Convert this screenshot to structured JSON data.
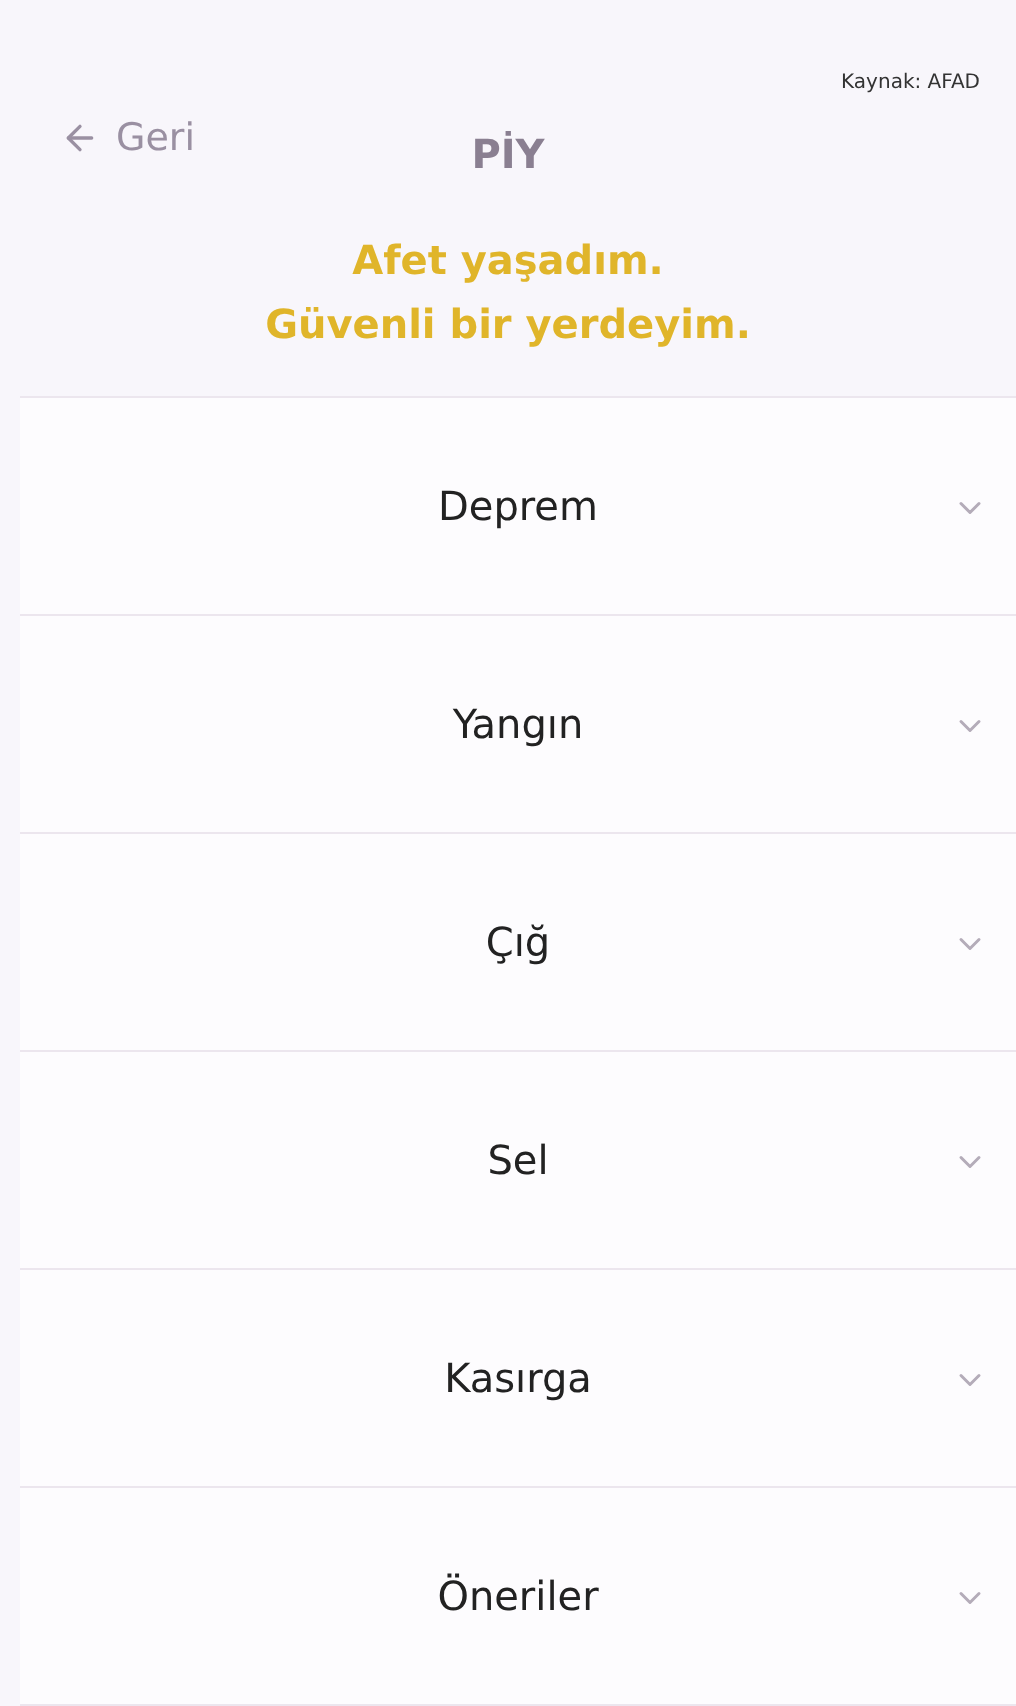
{
  "header": {
    "back": "Geri",
    "title": "PİY",
    "source": "Kaynak: AFAD",
    "heading": [
      "Afet yaşadım.",
      "Güvenli bir yerdeyim."
    ]
  },
  "sections": [
    {
      "label": "Deprem",
      "expanded": false
    },
    {
      "label": "Yangın",
      "expanded": false
    },
    {
      "label": "Çığ",
      "expanded": false
    },
    {
      "label": "Sel",
      "expanded": false
    },
    {
      "label": "Kasırga",
      "expanded": false
    },
    {
      "label": "Öneriler",
      "expanded": false
    }
  ]
}
